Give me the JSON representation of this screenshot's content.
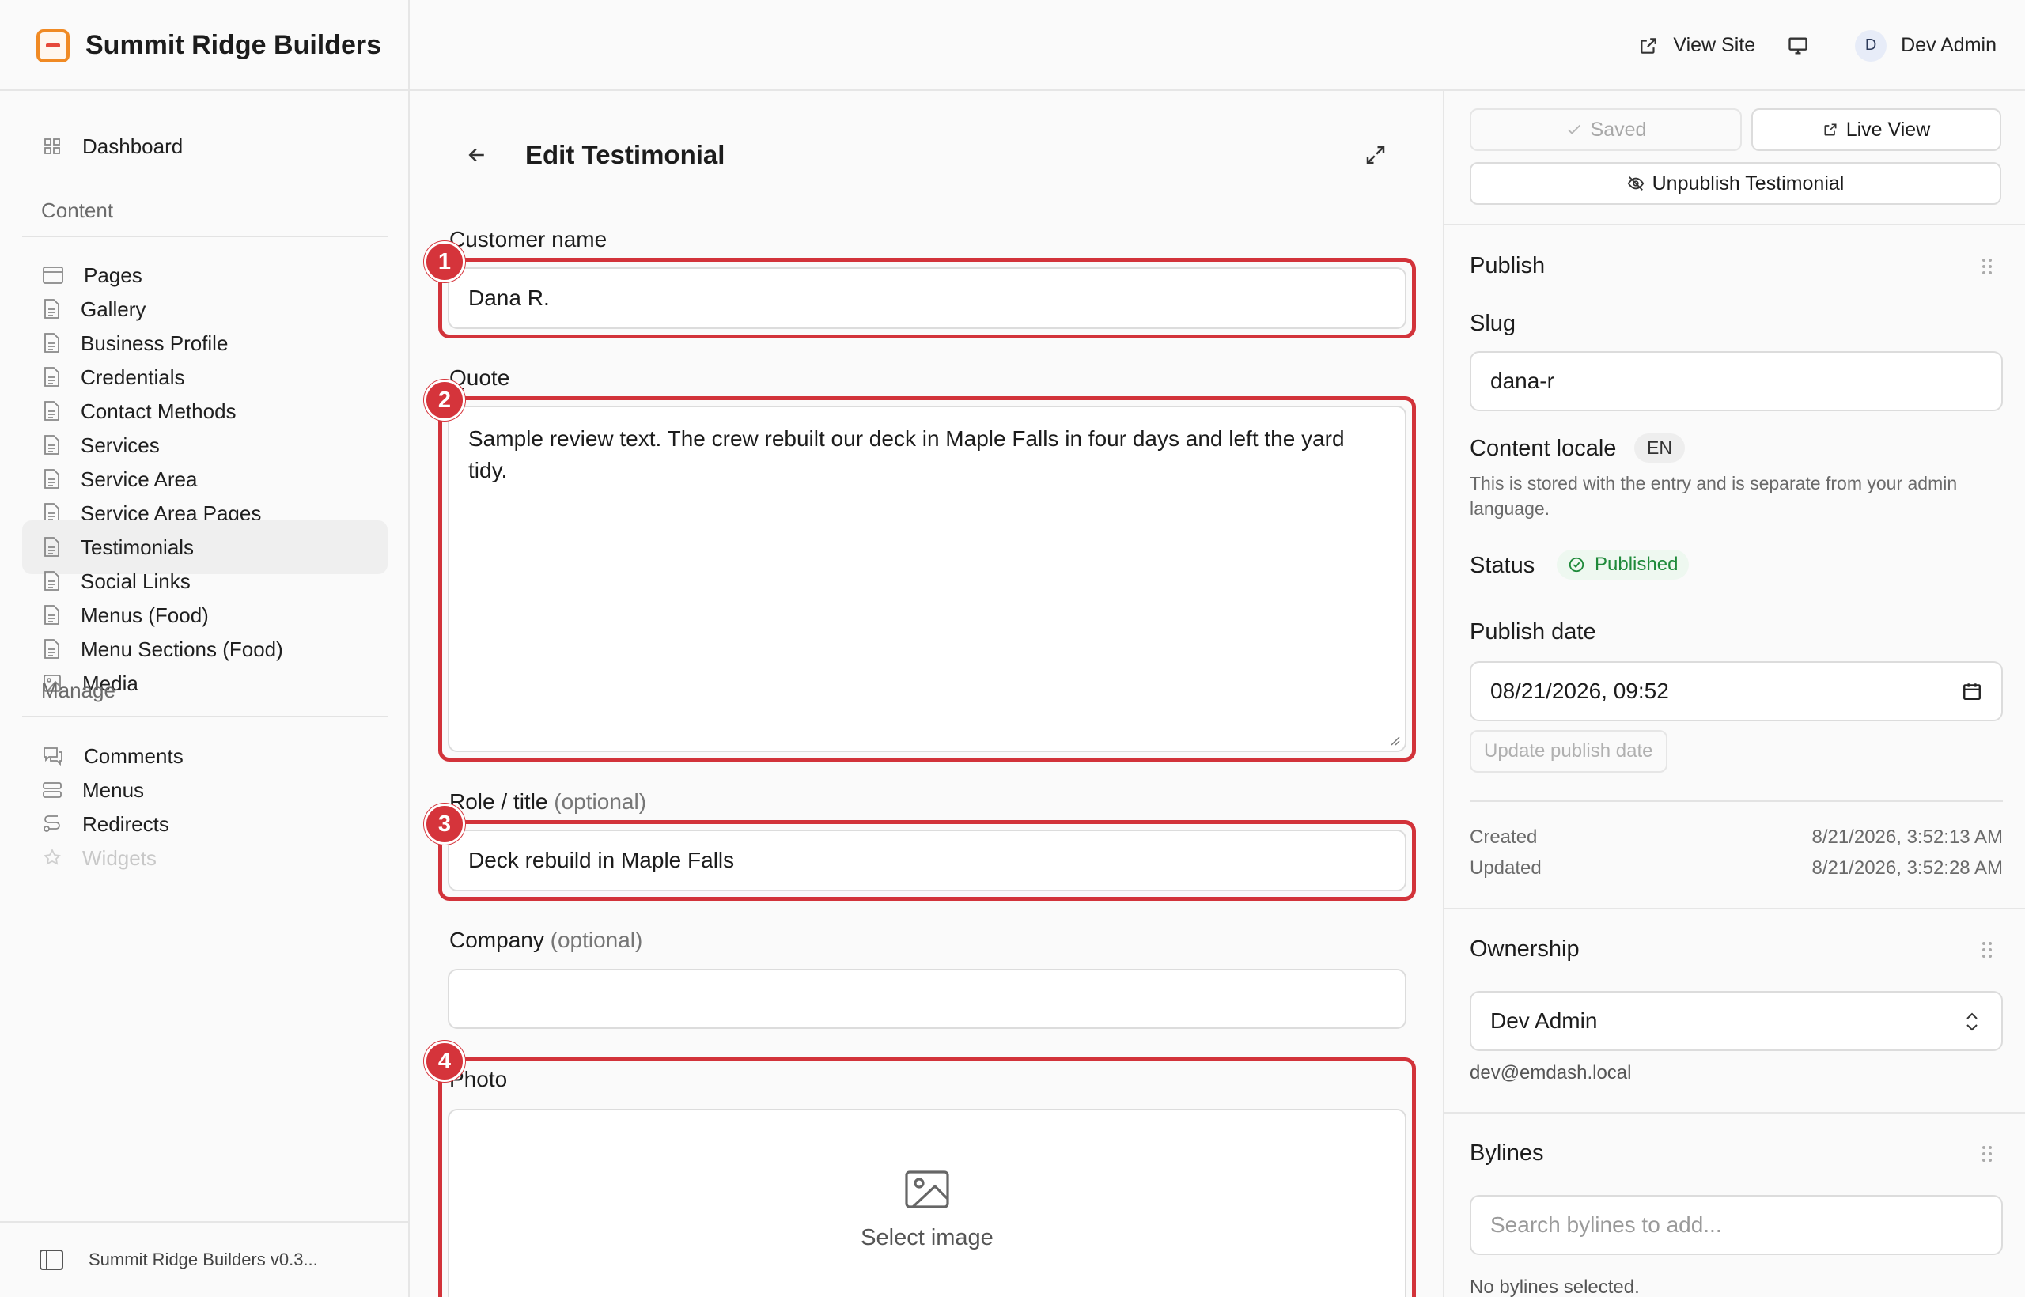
{
  "header": {
    "brand": "Summit Ridge Builders",
    "view_site": "View Site",
    "avatar_initial": "D",
    "user_name": "Dev Admin"
  },
  "sidebar": {
    "dashboard": "Dashboard",
    "section_content": "Content",
    "content_items": [
      "Pages",
      "Gallery",
      "Business Profile",
      "Credentials",
      "Contact Methods",
      "Services",
      "Service Area",
      "Service Area Pages",
      "Testimonials",
      "Social Links",
      "Menus (Food)",
      "Menu Sections (Food)",
      "Media"
    ],
    "active_item": "Testimonials",
    "section_manage": "Manage",
    "manage_items": [
      "Comments",
      "Menus",
      "Redirects",
      "Widgets"
    ],
    "footer": "Summit Ridge Builders v0.3..."
  },
  "editor": {
    "title": "Edit Testimonial",
    "customer_name_label": "Customer name",
    "customer_name_value": "Dana R.",
    "quote_label": "Quote",
    "quote_value": "Sample review text. The crew rebuilt our deck in Maple Falls in four days and left the yard tidy.",
    "role_label": "Role / title",
    "optional": "(optional)",
    "role_value": "Deck rebuild in Maple Falls",
    "company_label": "Company",
    "company_value": "",
    "photo_label": "Photo",
    "select_image": "Select image",
    "badges": [
      "1",
      "2",
      "3",
      "4"
    ]
  },
  "panel": {
    "saved": "Saved",
    "live_view": "Live View",
    "unpublish": "Unpublish Testimonial",
    "publish_title": "Publish",
    "slug_label": "Slug",
    "slug_value": "dana-r",
    "locale_label": "Content locale",
    "locale_value": "EN",
    "locale_help": "This is stored with the entry and is separate from your admin language.",
    "status_label": "Status",
    "status_value": "Published",
    "publish_date_label": "Publish date",
    "publish_date_value": "08/21/2026, 09:52",
    "update_publish_date": "Update publish date",
    "created_label": "Created",
    "created_value": "8/21/2026, 3:52:13 AM",
    "updated_label": "Updated",
    "updated_value": "8/21/2026, 3:52:28 AM",
    "ownership_title": "Ownership",
    "owner_value": "Dev Admin",
    "owner_email": "dev@emdash.local",
    "bylines_title": "Bylines",
    "bylines_placeholder": "Search bylines to add...",
    "bylines_empty": "No bylines selected."
  },
  "colors": {
    "accent_red": "#d2333a",
    "published_green": "#1f8a3a",
    "brand_orange": "#f08a24"
  }
}
